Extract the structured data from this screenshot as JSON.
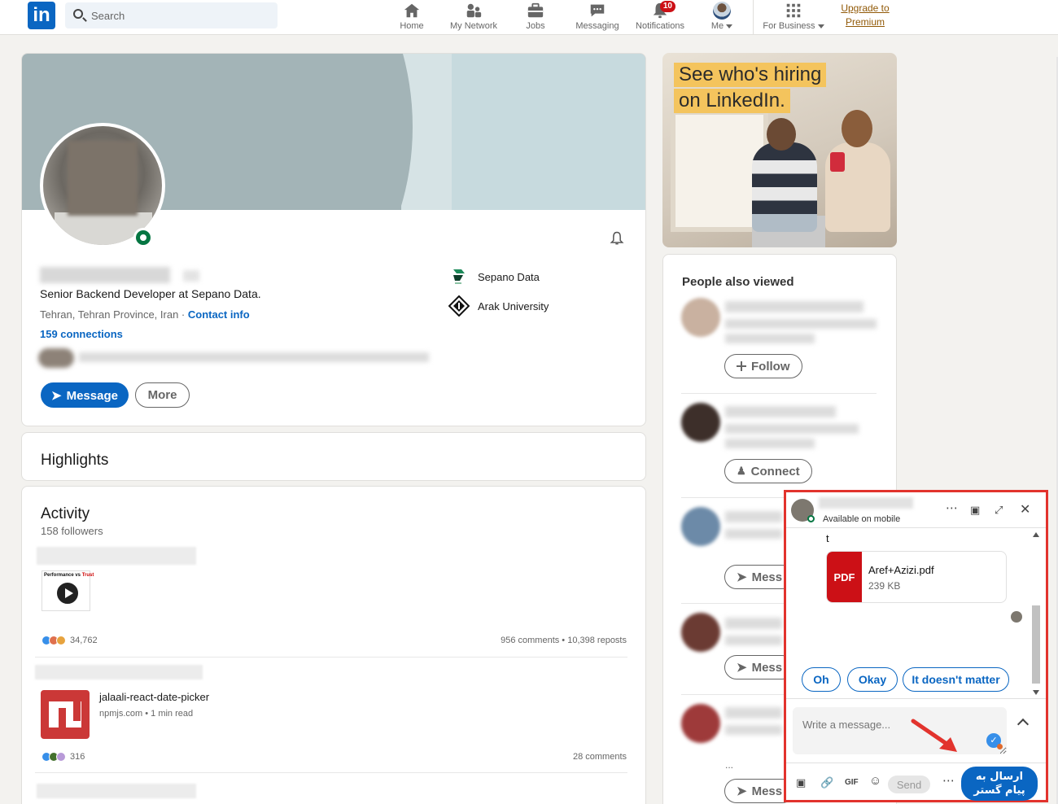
{
  "nav": {
    "logo": "in",
    "search_placeholder": "Search",
    "items": [
      {
        "label": "Home",
        "icon": "home-icon"
      },
      {
        "label": "My Network",
        "icon": "network-icon"
      },
      {
        "label": "Jobs",
        "icon": "briefcase-icon"
      },
      {
        "label": "Messaging",
        "icon": "chat-icon"
      },
      {
        "label": "Notifications",
        "icon": "bell-icon",
        "badge": "10"
      },
      {
        "label": "Me",
        "icon": "avatar"
      }
    ],
    "business": "For Business",
    "premium_line1": "Upgrade to",
    "premium_line2": "Premium"
  },
  "profile": {
    "headline": "Senior Backend Developer at Sepano Data.",
    "location": "Tehran, Tehran Province, Iran ·",
    "contact": "Contact info",
    "connections": "159 connections",
    "message_btn": "Message",
    "more_btn": "More",
    "orgs": [
      "Sepano Data",
      "Arak University"
    ]
  },
  "highlights": {
    "title": "Highlights"
  },
  "activity": {
    "title": "Activity",
    "followers": "158 followers",
    "post1": {
      "video_title": "Performance vs ",
      "video_title_accent": "Trust",
      "reactions": "34,762",
      "stats": "956 comments • 10,398 reposts"
    },
    "post2": {
      "title": "jalaali-react-date-picker",
      "source": "npmjs.com • 1 min read",
      "reactions": "316",
      "stats": "28 comments"
    }
  },
  "ad": {
    "line1": "See who's hiring",
    "line2": "on LinkedIn."
  },
  "people": {
    "title": "People also viewed",
    "follow": "Follow",
    "connect": "Connect",
    "message": "Mess",
    "ellipsis": "..."
  },
  "chat": {
    "status": "Available on mobile",
    "msg": "t",
    "file_badge": "PDF",
    "file_name": "Aref+Azizi.pdf",
    "file_size": "239 KB",
    "chips": [
      "Oh",
      "Okay",
      "It doesn't matter"
    ],
    "input_placeholder": "Write a message...",
    "send": "Send",
    "gif": "GIF",
    "persian_line1": "ارسال به",
    "persian_line2": "پیام گستر"
  }
}
